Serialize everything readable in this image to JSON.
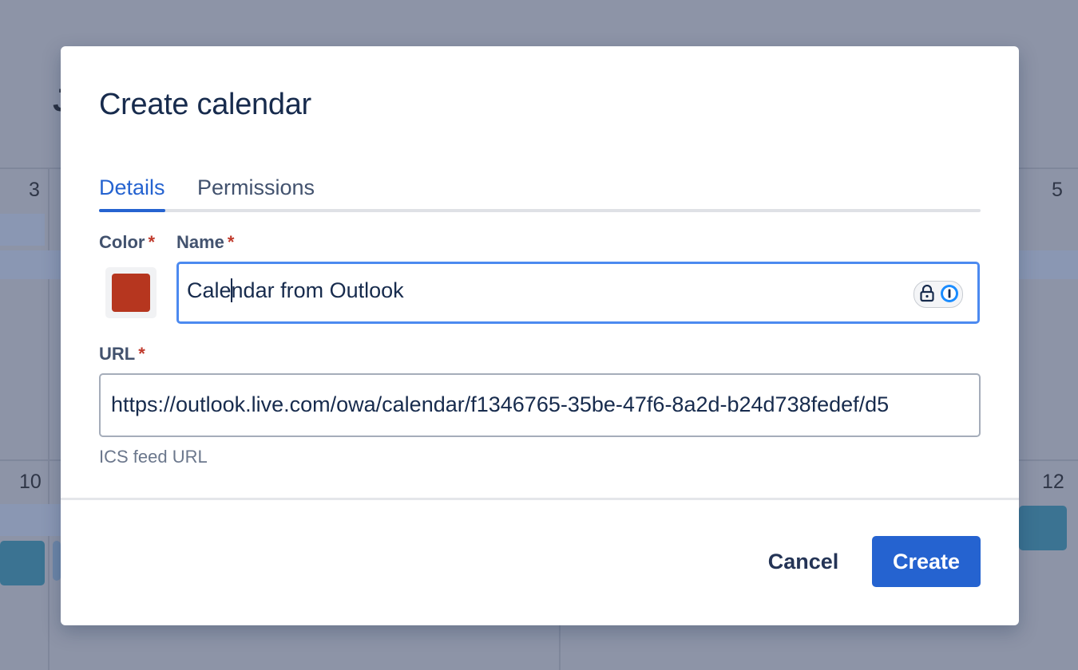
{
  "background": {
    "day_numbers": [
      "3",
      "5",
      "10",
      "12"
    ]
  },
  "dialog": {
    "title": "Create calendar",
    "tabs": [
      {
        "label": "Details",
        "active": true
      },
      {
        "label": "Permissions",
        "active": false
      }
    ],
    "color_field": {
      "label": "Color",
      "required_mark": "*",
      "value": "#b6361f"
    },
    "name_field": {
      "label": "Name",
      "required_mark": "*",
      "value_before_caret": "Cale",
      "value_after_caret": "ndar from Outlook",
      "password_manager_icon": "lock-icon"
    },
    "url_field": {
      "label": "URL",
      "required_mark": "*",
      "value": "https://outlook.live.com/owa/calendar/f1346765-35be-47f6-8a2d-b24d738fedef/d5",
      "helper": "ICS feed URL"
    },
    "buttons": {
      "cancel": "Cancel",
      "create": "Create"
    }
  },
  "colors": {
    "accent": "#2563d0",
    "required": "#c0392b",
    "title_text": "#172b4d"
  }
}
